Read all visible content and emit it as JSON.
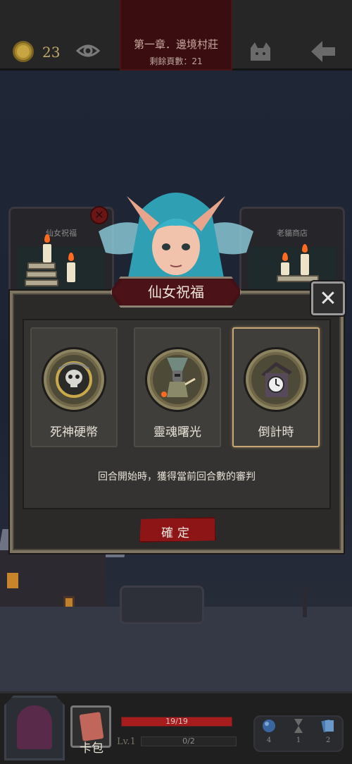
{
  "topbar": {
    "coin_count": "23",
    "chapter_title": "第一章．邊境村莊",
    "pages_left": "剩餘頁數：21"
  },
  "scene": {
    "shop_left_label": "仙女祝福",
    "shop_right_label": "老貓商店"
  },
  "dialog": {
    "title": "仙女祝福",
    "close_label": "✕",
    "options": [
      {
        "label": "死神硬幣",
        "icon": "death-coin-icon",
        "selected": false
      },
      {
        "label": "靈魂曙光",
        "icon": "soul-dawn-icon",
        "selected": false
      },
      {
        "label": "倒計時",
        "icon": "cuckoo-clock-icon",
        "selected": true
      }
    ],
    "description": "回合開始時，獲得當前回合數的審判",
    "confirm_label": "確定"
  },
  "bottombar": {
    "cardpack_label": "卡包",
    "level": "Lv.1",
    "hp_text": "19/19",
    "hp_ratio": 1.0,
    "xp_text": "0/2",
    "xp_ratio": 0.0,
    "inventory": [
      {
        "icon": "orb-icon",
        "count": "4"
      },
      {
        "icon": "hourglass-icon",
        "count": "1"
      },
      {
        "icon": "cards-icon",
        "count": "2"
      }
    ]
  },
  "colors": {
    "accent_red": "#8e1515",
    "frame_gold": "#c9a774",
    "panel_dark": "#2b2a29"
  }
}
